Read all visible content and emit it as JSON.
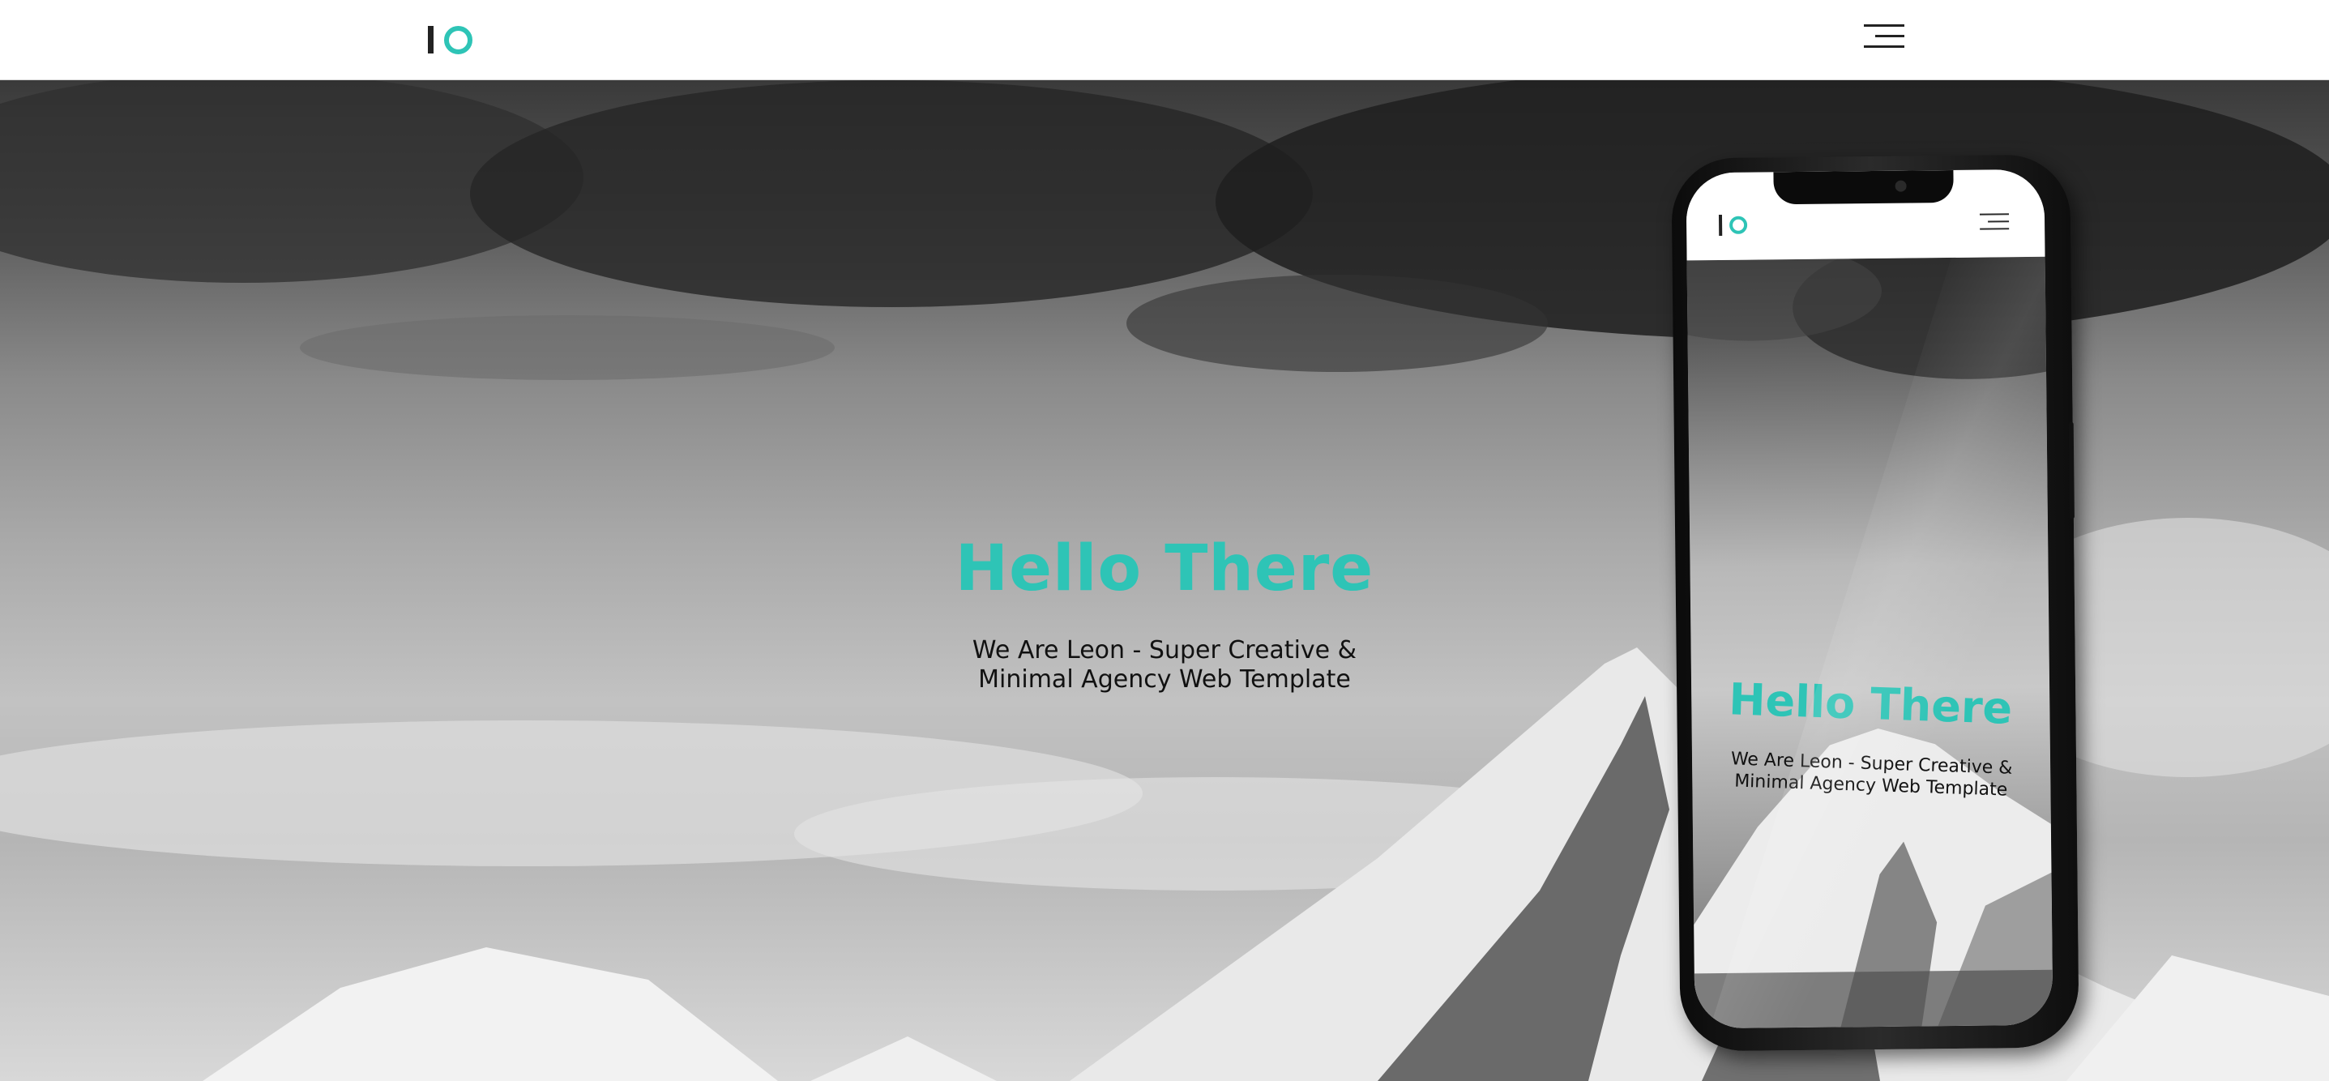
{
  "header": {
    "logo_alt": "IO",
    "menu_icon": "hamburger-menu-icon"
  },
  "hero": {
    "title": "Hello There",
    "subtitle": "We Are Leon - Super Creative & Minimal Agency Web Template"
  },
  "phone": {
    "title": "Hello There",
    "subtitle": "We Are Leon - Super Creative & Minimal Agency Web Template",
    "menu_icon": "hamburger-menu-icon"
  },
  "colors": {
    "accent": "#2ec4b6",
    "text_dark": "#111111",
    "header_bg": "#ffffff"
  }
}
